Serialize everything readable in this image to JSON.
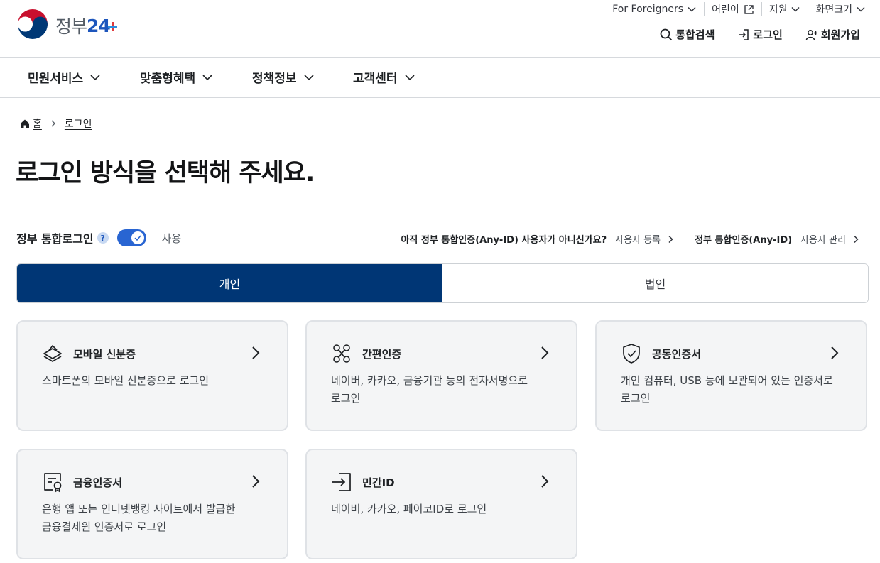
{
  "header": {
    "logo_text": "정부",
    "logo_num": "24",
    "util": {
      "foreigners": "For Foreigners",
      "kids": "어린이",
      "support": "지원",
      "screen_size": "화면크기"
    },
    "actions": {
      "search": "통합검색",
      "login": "로그인",
      "signup": "회원가입"
    }
  },
  "gnb": {
    "items": [
      {
        "label": "민원서비스"
      },
      {
        "label": "맞춤형혜택"
      },
      {
        "label": "정책정보"
      },
      {
        "label": "고객센터"
      }
    ]
  },
  "breadcrumb": {
    "home": "홈",
    "current": "로그인"
  },
  "page_title": "로그인 방식을 선택해 주세요.",
  "integrated_login": {
    "label": "정부 통합로그인",
    "help": "?",
    "toggle_state": "사용",
    "toggle_on": true
  },
  "registration": {
    "question": "아직 정부 통합인증(Any-ID) 사용자가 아니신가요?",
    "register_link": "사용자 등록",
    "anyid_label": "정부 통합인증(Any-ID)",
    "manage_link": "사용자 관리"
  },
  "tabs": [
    {
      "label": "개인",
      "active": true
    },
    {
      "label": "법인",
      "active": false
    }
  ],
  "cards": [
    {
      "icon": "mobile-id-icon",
      "title": "모바일 신분증",
      "desc": "스마트폰의 모바일 신분증으로 로그인"
    },
    {
      "icon": "simple-auth-icon",
      "title": "간편인증",
      "desc": "네이버, 카카오, 금융기관 등의 전자서명으로 로그인"
    },
    {
      "icon": "shield-check-icon",
      "title": "공동인증서",
      "desc": "개인 컴퓨터, USB 등에 보관되어 있는 인증서로 로그인"
    },
    {
      "icon": "certificate-icon",
      "title": "금융인증서",
      "desc": "은행 앱 또는 인터넷뱅킹 사이트에서 발급한 금융결제원 인증서로 로그인"
    },
    {
      "icon": "login-arrow-icon",
      "title": "민간ID",
      "desc": "네이버, 카카오, 페이코ID로 로그인"
    }
  ],
  "colors": {
    "primary_navy": "#003675",
    "toggle_blue": "#2965d2",
    "card_bg": "#f4f5f6"
  }
}
